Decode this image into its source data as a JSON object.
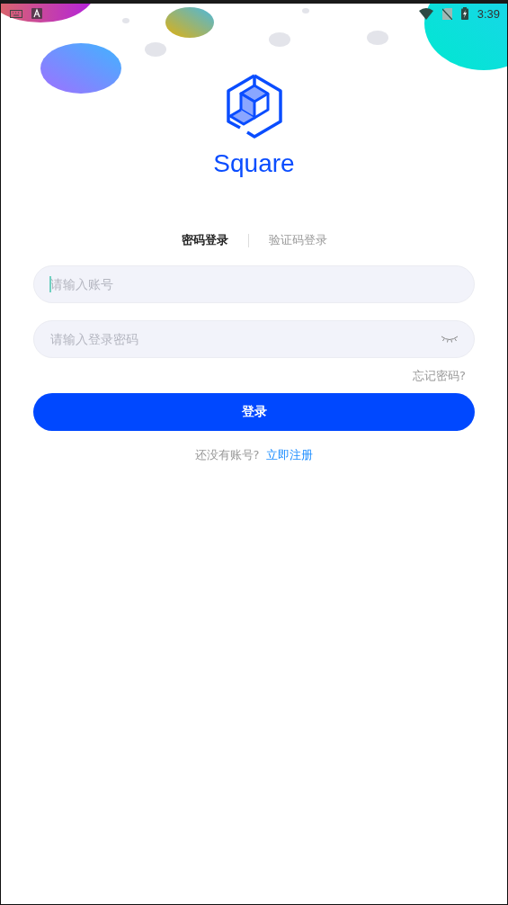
{
  "status_bar": {
    "time": "3:39"
  },
  "app": {
    "name": "Square"
  },
  "tabs": [
    {
      "label": "密码登录",
      "selected": true
    },
    {
      "label": "验证码登录",
      "selected": false
    }
  ],
  "fields": [
    {
      "kind": "text",
      "placeholder": "请输入账号",
      "focused": true
    },
    {
      "kind": "password",
      "placeholder": "请输入登录密码",
      "focused": false
    }
  ],
  "forgot_link": "忘记密码?",
  "login_button": "登录",
  "signup": {
    "prompt": "还没有账号?",
    "link": "立即注册"
  }
}
